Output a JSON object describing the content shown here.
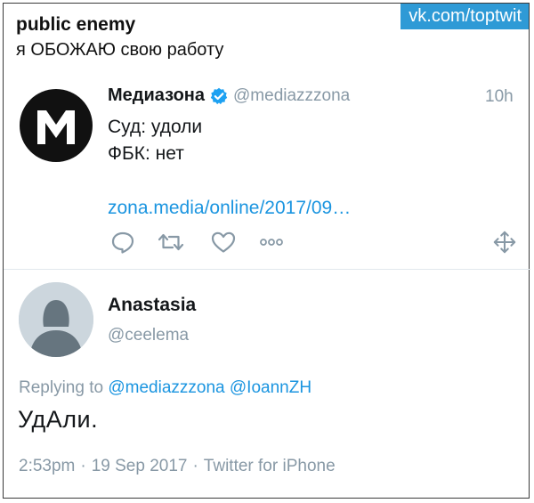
{
  "post": {
    "author": "public enemy",
    "text": "я ОБОЖАЮ свою работу",
    "watermark": "vk.com/toptwit"
  },
  "quoted_tweet": {
    "avatar_letter": "M",
    "name": "Медиазона",
    "handle": "@mediazzzona",
    "time": "10h",
    "line1": "Суд: удоли",
    "line2": "ФБК: нет",
    "link": "zona.media/online/2017/09…",
    "icons": [
      "reply-icon",
      "retweet-icon",
      "like-icon",
      "more-icon",
      "move-icon"
    ]
  },
  "reply_tweet": {
    "name": "Anastasia",
    "handle": "@ceelema",
    "replying_prefix": "Replying to",
    "mention1": "@mediazzzona",
    "mention2": "@IoannZH",
    "text": "УдАли.",
    "time": "2:53pm",
    "date": "19 Sep 2017",
    "source": "Twitter for iPhone",
    "separator": "·"
  },
  "colors": {
    "link": "#1b95e0",
    "muted": "#8899a6",
    "watermark_bg": "#2e9ad6",
    "verified": "#1da1f2"
  }
}
